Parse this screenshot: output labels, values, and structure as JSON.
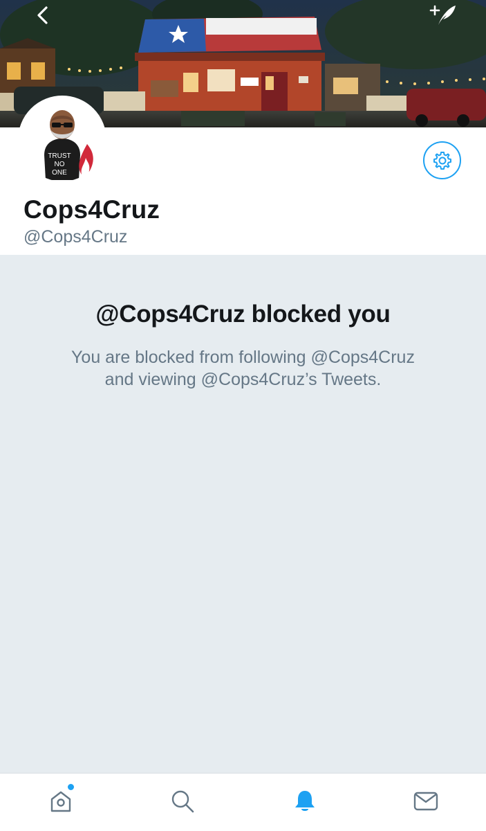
{
  "header": {
    "back_icon": "chevron-left-icon",
    "compose_icon": "compose-tweet-icon"
  },
  "profile": {
    "display_name": "Cops4Cruz",
    "handle": "@Cops4Cruz",
    "avatar_caption": [
      "TRUST",
      "NO",
      "ONE"
    ],
    "settings_icon": "gear-icon"
  },
  "blocked": {
    "title": "@Cops4Cruz blocked you",
    "body_line1": "You are blocked from following @Cops4Cruz",
    "body_line2": "and viewing @Cops4Cruz’s Tweets."
  },
  "tabbar": {
    "items": [
      {
        "icon": "home-icon",
        "active": false,
        "has_dot": true
      },
      {
        "icon": "search-icon",
        "active": false
      },
      {
        "icon": "notifications-icon",
        "active": true
      },
      {
        "icon": "messages-icon",
        "active": false
      }
    ]
  },
  "colors": {
    "accent": "#1da1f2",
    "text_primary": "#14171a",
    "text_secondary": "#657786",
    "panel_bg": "#e6ecf0"
  }
}
